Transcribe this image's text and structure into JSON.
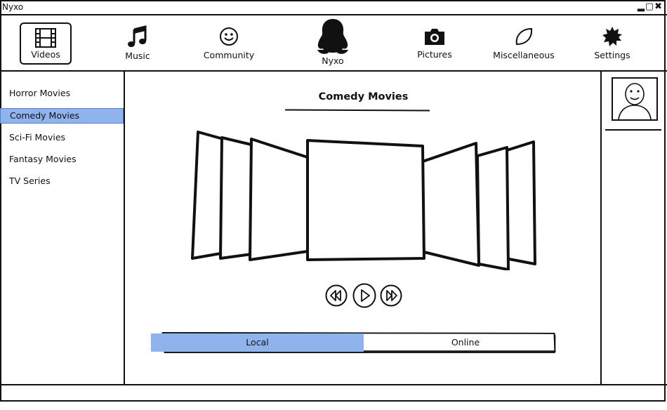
{
  "window": {
    "title": "Nyxo",
    "controls": "▂▢✖"
  },
  "nav": {
    "items": [
      {
        "label": "Videos",
        "icon": "film-icon",
        "selected": true
      },
      {
        "label": "Music",
        "icon": "music-note-icon"
      },
      {
        "label": "Community",
        "icon": "smiley-icon"
      },
      {
        "label": "Nyxo",
        "icon": "penguin-logo-icon"
      },
      {
        "label": "Pictures",
        "icon": "camera-icon"
      },
      {
        "label": "Miscellaneous",
        "icon": "leaf-icon"
      },
      {
        "label": "Settings",
        "icon": "gear-icon"
      }
    ]
  },
  "sidebar": {
    "items": [
      {
        "label": "Horror Movies"
      },
      {
        "label": "Comedy Movies",
        "selected": true
      },
      {
        "label": "Sci-Fi Movies"
      },
      {
        "label": "Fantasy Movies"
      },
      {
        "label": "TV Series"
      }
    ]
  },
  "main": {
    "title": "Comedy Movies",
    "source": {
      "options": [
        "Local",
        "Online"
      ],
      "selected": "Local"
    }
  },
  "colors": {
    "selection": "#8fb3ec",
    "ink": "#111111"
  }
}
